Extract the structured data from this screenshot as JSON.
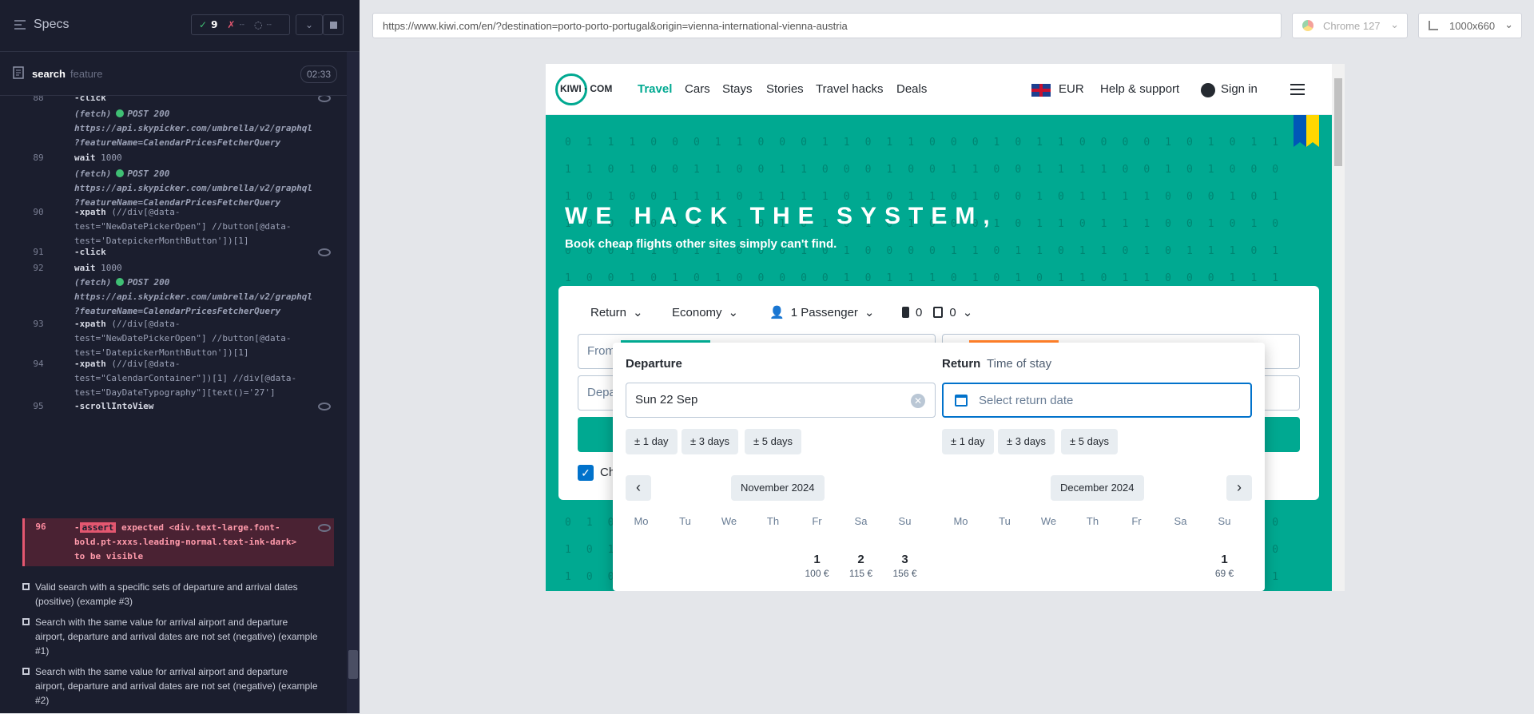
{
  "runner": {
    "title": "Specs",
    "passed": "9",
    "failed": "--",
    "pending": "--",
    "spec_name": "search",
    "spec_ext": "feature",
    "duration": "02:33",
    "commands": [
      {
        "num": "88",
        "label": "-click"
      },
      {
        "num": "",
        "label": "(fetch)",
        "method": "POST 200",
        "url": "https://api.skypicker.com/umbrella/v2/graphql\n?featureName=CalendarPricesFetcherQuery"
      },
      {
        "num": "89",
        "label": "wait",
        "arg": "1000"
      },
      {
        "num": "",
        "label": "(fetch)",
        "method": "POST 200",
        "url": "https://api.skypicker.com/umbrella/v2/graphql\n?featureName=CalendarPricesFetcherQuery"
      },
      {
        "num": "90",
        "label": "-xpath",
        "arg": "(//div[@data-\ntest=\"NewDatePickerOpen\"] //button[@data-\ntest='DatepickerMonthButton'])[1]"
      },
      {
        "num": "91",
        "label": "-click"
      },
      {
        "num": "92",
        "label": "wait",
        "arg": "1000"
      },
      {
        "num": "",
        "label": "(fetch)",
        "method": "POST 200",
        "url": "https://api.skypicker.com/umbrella/v2/graphql\n?featureName=CalendarPricesFetcherQuery"
      },
      {
        "num": "93",
        "label": "-xpath",
        "arg": "(//div[@data-\ntest=\"NewDatePickerOpen\"] //button[@data-\ntest='DatepickerMonthButton'])[1]"
      },
      {
        "num": "94",
        "label": "-xpath",
        "arg": "(//div[@data-\ntest=\"CalendarContainer\"])[1] //div[@data-\ntest=\"DayDateTypography\"][text()='27']"
      },
      {
        "num": "95",
        "label": "-scrollIntoView"
      }
    ],
    "failed_cmd": {
      "num": "96",
      "prefix": "-",
      "keyword": "assert",
      "text1": " expected <div.text-large.font-",
      "text2": "bold.pt-xxxs.leading-normal.text-ink-dark>",
      "text3": "to be visible"
    },
    "tests": [
      "Valid search with a specific sets of departure and arrival dates (positive) (example #3)",
      "Search with the same value for arrival airport and departure airport, departure and arrival dates are not set (negative) (example #1)",
      "Search with the same value for arrival airport and departure airport, departure and arrival dates are not set (negative) (example #2)"
    ]
  },
  "browser": {
    "url": "https://www.kiwi.com/en/?destination=porto-porto-portugal&origin=vienna-international-vienna-austria",
    "browser_name": "Chrome 127",
    "viewport": "1000x660"
  },
  "kiwi": {
    "logo": "KIWI · COM",
    "nav": [
      "Travel",
      "Cars",
      "Stays",
      "Stories",
      "Travel hacks",
      "Deals"
    ],
    "currency": "EUR",
    "help": "Help & support",
    "signin": "Sign in",
    "hero_title": "WE HACK THE SYSTEM,",
    "hero_sub": "Book cheap flights other sites simply can't find.",
    "trip_type": "Return",
    "cabin": "Economy",
    "passengers": "1 Passenger",
    "bags_cabin": "0",
    "bags_checked": "0",
    "from_placeholder": "From",
    "depart_placeholder": "Depa",
    "checkbox_label": "Ch",
    "accent": "#00a991"
  },
  "datepicker": {
    "departure_label": "Departure",
    "return_label": "Return",
    "time_of_stay": "Time of stay",
    "departure_value": "Sun 22 Sep",
    "return_placeholder": "Select return date",
    "flex_chips": [
      "± 1 day",
      "± 3 days",
      "± 5 days"
    ],
    "month1": "November 2024",
    "month2": "December 2024",
    "weekdays": [
      "Mo",
      "Tu",
      "We",
      "Th",
      "Fr",
      "Sa",
      "Su"
    ],
    "nov_days": [
      {
        "day": "1",
        "price": "100 €"
      },
      {
        "day": "2",
        "price": "115 €"
      },
      {
        "day": "3",
        "price": "156 €"
      }
    ],
    "dec_days": [
      {
        "day": "1",
        "price": "69 €"
      }
    ]
  }
}
